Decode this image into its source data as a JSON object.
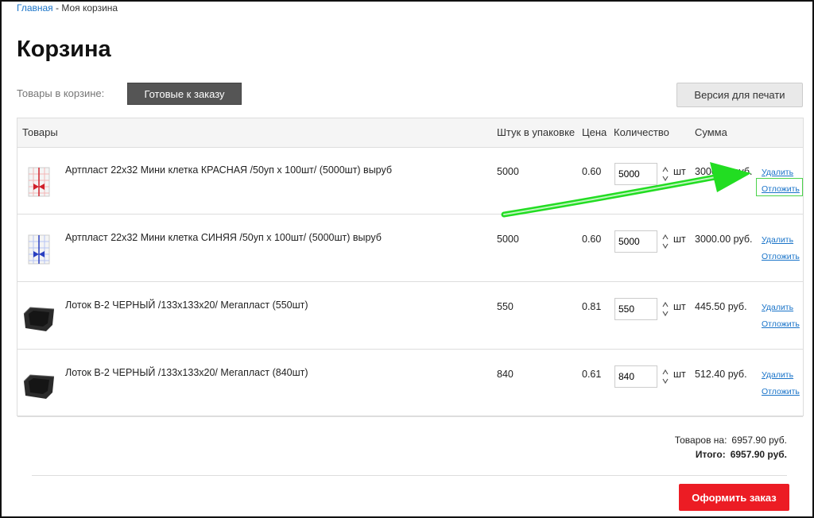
{
  "breadcrumb": {
    "home": "Главная",
    "separator": " - ",
    "current": "Моя корзина"
  },
  "title": "Корзина",
  "cart_label": "Товары в корзине:",
  "ready_button": "Готовые к заказу",
  "print_button": "Версия для печати",
  "headers": {
    "products": "Товары",
    "per_pack": "Штук в упаковке",
    "price": "Цена",
    "quantity": "Количество",
    "sum": "Сумма"
  },
  "rows": [
    {
      "name": "Артпласт 22х32 Мини клетка КРАСНАЯ /50уп х 100шт/ (5000шт) выруб",
      "per_pack": "5000",
      "price": "0.60",
      "qty": "5000",
      "unit": "шт",
      "sum": "3000.00 руб.",
      "delete": "Удалить",
      "defer": "Отложить",
      "thumb_icon": "red-bag-icon"
    },
    {
      "name": "Артпласт 22х32 Мини клетка СИНЯЯ /50уп х 100шт/ (5000шт) выруб",
      "per_pack": "5000",
      "price": "0.60",
      "qty": "5000",
      "unit": "шт",
      "sum": "3000.00 руб.",
      "delete": "Удалить",
      "defer": "Отложить",
      "thumb_icon": "blue-bag-icon"
    },
    {
      "name": "Лоток В-2 ЧЕРНЫЙ /133х133х20/ Мегапласт (550шт)",
      "per_pack": "550",
      "price": "0.81",
      "qty": "550",
      "unit": "шт",
      "sum": "445.50 руб.",
      "delete": "Удалить",
      "defer": "Отложить",
      "thumb_icon": "black-tray-icon"
    },
    {
      "name": "Лоток В-2 ЧЕРНЫЙ /133х133х20/ Мегапласт (840шт)",
      "per_pack": "840",
      "price": "0.61",
      "qty": "840",
      "unit": "шт",
      "sum": "512.40 руб.",
      "delete": "Удалить",
      "defer": "Отложить",
      "thumb_icon": "black-tray-icon"
    }
  ],
  "totals": {
    "items_label": "Товаров на:",
    "items_value": "6957.90 руб.",
    "total_label": "Итого:",
    "total_value": "6957.90 руб."
  },
  "order_button": "Оформить заказ",
  "colors": {
    "link": "#1a74c9",
    "order_button": "#ec1c24",
    "ready_button": "#555555",
    "annotation": "#22dd22"
  }
}
